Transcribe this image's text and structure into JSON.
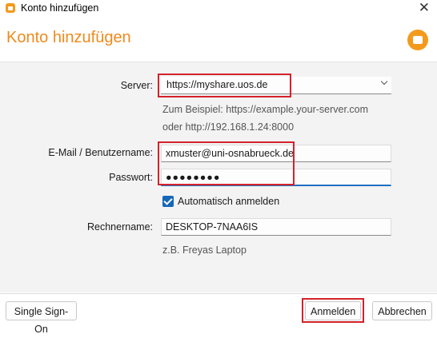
{
  "window": {
    "title": "Konto hinzufügen"
  },
  "header": {
    "title": "Konto hinzufügen"
  },
  "form": {
    "server": {
      "label": "Server:",
      "value": "https://myshare.uos.de",
      "hint_line1": "Zum Beispiel: https://example.your-server.com",
      "hint_line2": "oder http://192.168.1.24:8000"
    },
    "email": {
      "label": "E-Mail / Benutzername:",
      "value": "xmuster@uni-osnabrueck.de"
    },
    "password": {
      "label": "Passwort:",
      "value": "●●●●●●●●"
    },
    "auto_login": {
      "label": "Automatisch anmelden",
      "checked": true
    },
    "computer_name": {
      "label": "Rechnername:",
      "value": "DESKTOP-7NAA6IS",
      "hint": "z.B. Freyas Laptop"
    }
  },
  "footer": {
    "sso_label": "Single Sign-On",
    "login_label": "Anmelden",
    "cancel_label": "Abbrechen"
  },
  "colors": {
    "brand": "#f08a1c",
    "accent": "#1667b8",
    "highlight": "#d4222a"
  }
}
